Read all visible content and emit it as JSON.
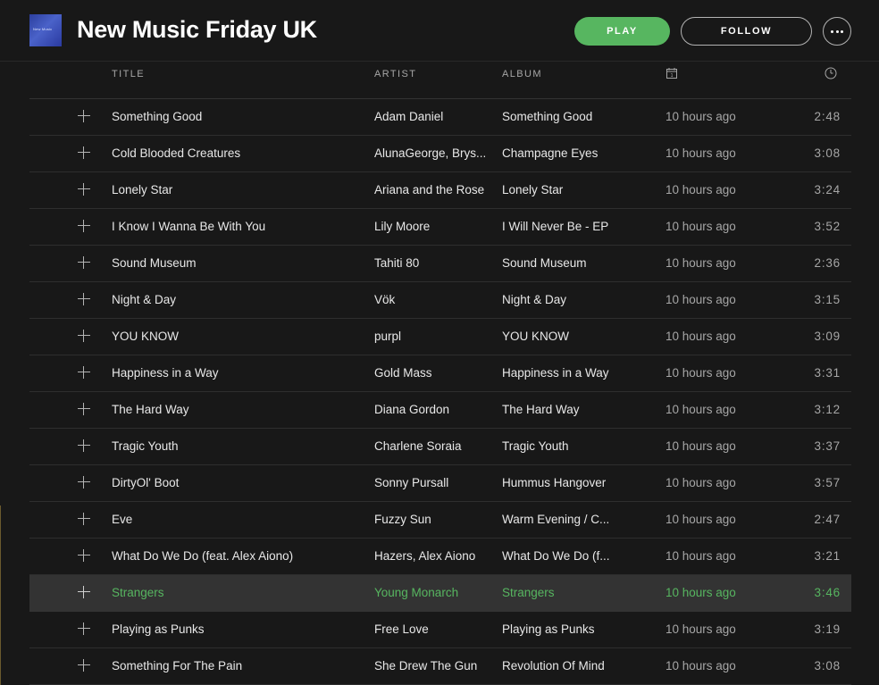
{
  "header": {
    "title": "New Music Friday UK",
    "cover_text": "New Music",
    "play_label": "PLAY",
    "follow_label": "FOLLOW",
    "more_icon": "more-options-icon",
    "accent_color": "#57b660"
  },
  "columns": {
    "title": "TITLE",
    "artist": "ARTIST",
    "album": "ALBUM",
    "added_icon": "calendar-icon",
    "duration_icon": "clock-icon"
  },
  "tracks": [
    {
      "title": "Something Good",
      "artist": "Adam Daniel",
      "album": "Something Good",
      "added": "10 hours ago",
      "duration": "2:48"
    },
    {
      "title": "Cold Blooded Creatures",
      "artist": "AlunaGeorge, Brys...",
      "album": "Champagne Eyes",
      "added": "10 hours ago",
      "duration": "3:08"
    },
    {
      "title": "Lonely Star",
      "artist": "Ariana and the Rose",
      "album": "Lonely Star",
      "added": "10 hours ago",
      "duration": "3:24"
    },
    {
      "title": "I Know I Wanna Be With You",
      "artist": "Lily Moore",
      "album": "I Will Never Be - EP",
      "added": "10 hours ago",
      "duration": "3:52"
    },
    {
      "title": "Sound Museum",
      "artist": "Tahiti 80",
      "album": "Sound Museum",
      "added": "10 hours ago",
      "duration": "2:36"
    },
    {
      "title": "Night & Day",
      "artist": "Vök",
      "album": "Night & Day",
      "added": "10 hours ago",
      "duration": "3:15"
    },
    {
      "title": "YOU KNOW",
      "artist": "purpl",
      "album": "YOU KNOW",
      "added": "10 hours ago",
      "duration": "3:09"
    },
    {
      "title": "Happiness in a Way",
      "artist": "Gold Mass",
      "album": "Happiness in a Way",
      "added": "10 hours ago",
      "duration": "3:31"
    },
    {
      "title": "The Hard Way",
      "artist": "Diana Gordon",
      "album": "The Hard Way",
      "added": "10 hours ago",
      "duration": "3:12"
    },
    {
      "title": "Tragic Youth",
      "artist": "Charlene Soraia",
      "album": "Tragic Youth",
      "added": "10 hours ago",
      "duration": "3:37"
    },
    {
      "title": "DirtyOl' Boot",
      "artist": "Sonny Pursall",
      "album": "Hummus Hangover",
      "added": "10 hours ago",
      "duration": "3:57"
    },
    {
      "title": "Eve",
      "artist": "Fuzzy Sun",
      "album": "Warm Evening / C...",
      "added": "10 hours ago",
      "duration": "2:47"
    },
    {
      "title": "What Do We Do (feat. Alex Aiono)",
      "artist": "Hazers, Alex Aiono",
      "album": "What Do We Do (f...",
      "added": "10 hours ago",
      "duration": "3:21"
    },
    {
      "title": "Strangers",
      "artist": "Young Monarch",
      "album": "Strangers",
      "added": "10 hours ago",
      "duration": "3:46",
      "active": true
    },
    {
      "title": "Playing as Punks",
      "artist": "Free Love",
      "album": "Playing as Punks",
      "added": "10 hours ago",
      "duration": "3:19"
    },
    {
      "title": "Something For The Pain",
      "artist": "She Drew The Gun",
      "album": "Revolution Of Mind",
      "added": "10 hours ago",
      "duration": "3:08"
    }
  ]
}
